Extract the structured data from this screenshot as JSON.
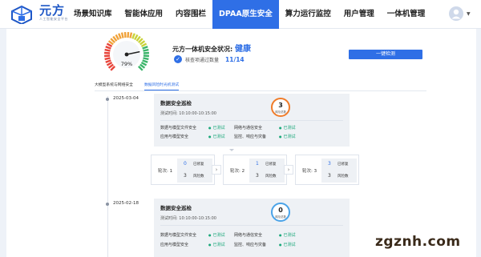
{
  "brand": {
    "name": "元方",
    "subtitle": "人工智能安全平台"
  },
  "nav": {
    "items": [
      {
        "label": "场景知识库"
      },
      {
        "label": "智能体应用"
      },
      {
        "label": "内容围栏"
      },
      {
        "label": "DPAA原生安全",
        "active": true
      },
      {
        "label": "算力运行监控"
      },
      {
        "label": "用户管理"
      },
      {
        "label": "一体机管理"
      }
    ]
  },
  "status": {
    "gauge_value": "79%",
    "gauge_fraction": 0.79,
    "prefix": "元方一体机安全状况:",
    "state": "健康",
    "passed_label": "核查项通过数量",
    "passed_count": "11/14",
    "detect_button": "一键检测"
  },
  "subtabs": [
    {
      "label": "大模型系统与网络安全",
      "active": false
    },
    {
      "label": "数据风险时光机测试",
      "active": true
    }
  ],
  "records": [
    {
      "date": "2025-03-04",
      "title": "数据安全巡检",
      "time": "测试时间: 10:10:00-10:15:00",
      "risk_count": "3",
      "risk_label": "风险总数",
      "risk_color": "#f07c2a",
      "items": [
        {
          "name": "数据与模型文件安全",
          "status": "已测试"
        },
        {
          "name": "网络与通信安全",
          "status": "已测试"
        },
        {
          "name": "应用与模型安全",
          "status": "已测试"
        },
        {
          "name": "监控、响应与灾备",
          "status": "已测试"
        }
      ]
    },
    {
      "date": "2025-02-18",
      "title": "数据安全巡检",
      "time": "测试时间: 10:10:00-10:15:00",
      "risk_count": "0",
      "risk_label": "风险总数",
      "risk_color": "#4aa3e8",
      "items": [
        {
          "name": "数据与模型文件安全",
          "status": "已测试"
        },
        {
          "name": "网络与通信安全",
          "status": "已测试"
        },
        {
          "name": "应用与模型安全",
          "status": "已测试"
        },
        {
          "name": "监控、响应与灾备",
          "status": "已测试"
        }
      ]
    }
  ],
  "rounds": [
    {
      "label": "轮次: 1",
      "fixed": "0",
      "fixed_label": "已修复",
      "risk": "3",
      "risk_label": "风险数"
    },
    {
      "label": "轮次: 2",
      "fixed": "1",
      "fixed_label": "已修复",
      "risk": "3",
      "risk_label": "风险数"
    },
    {
      "label": "轮次: 3",
      "fixed": "3",
      "fixed_label": "已修复",
      "risk": "3",
      "risk_label": "风险数"
    }
  ],
  "watermark": "zgznh.com"
}
